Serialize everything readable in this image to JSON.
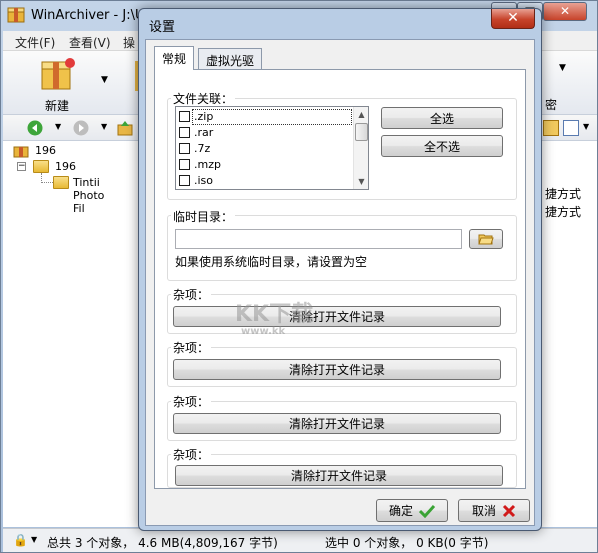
{
  "main": {
    "title": "WinArchiver - J:\\Us",
    "menu": [
      "文件(F)",
      "查看(V)",
      "操"
    ],
    "toolbar_new": "新建",
    "toolbar_right": "密",
    "tree": [
      "196",
      "196",
      "Tintii Photo Fil"
    ],
    "right_text": [
      "捷方式",
      "捷方式"
    ],
    "status_left": "总共 3 个对象， 4.6 MB(4,809,167 字节)",
    "status_right": "选中 0 个对象， 0 KB(0 字节)"
  },
  "dialog": {
    "title": "设置",
    "close": "✕",
    "tabs": [
      "常规",
      "虚拟光驱"
    ],
    "file_assoc": {
      "label": "文件关联：",
      "items": [
        ".zip",
        ".rar",
        ".7z",
        ".mzp",
        ".iso"
      ],
      "select_all": "全选",
      "select_none": "全不选"
    },
    "temp_dir": {
      "label": "临时目录：",
      "value": "",
      "hint": "如果使用系统临时目录，请设置为空"
    },
    "misc_groups": [
      {
        "label": "杂项：",
        "button": "清除打开文件记录"
      },
      {
        "label": "杂项：",
        "button": "清除打开文件记录"
      },
      {
        "label": "杂项：",
        "button": "清除打开文件记录"
      },
      {
        "label": "杂项：",
        "button": "清除打开文件记录"
      }
    ],
    "ok": "确定",
    "cancel": "取消"
  },
  "watermark": {
    "text": "KK下载",
    "url": "www.kk"
  },
  "colors": {
    "ok_check": "#3aa335",
    "cancel_x": "#d11a1a",
    "dialog_frame": "#b9cde5"
  }
}
